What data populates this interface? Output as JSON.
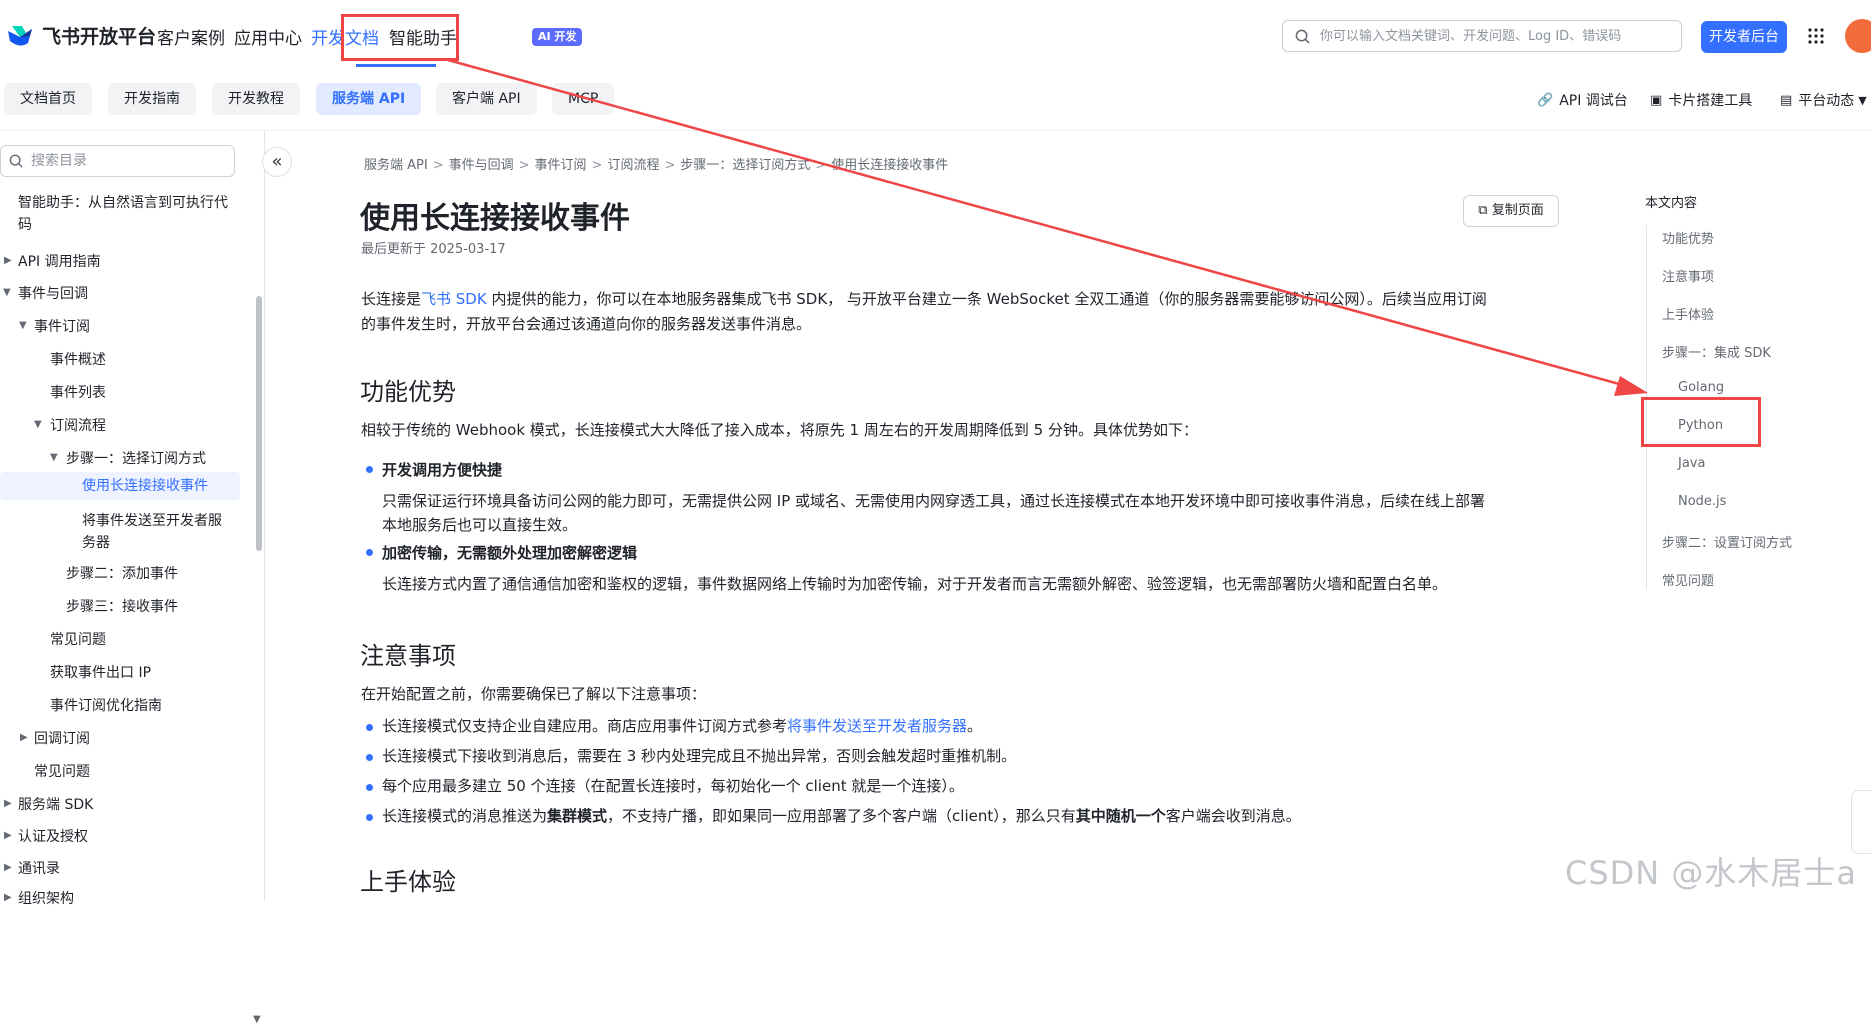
{
  "brand": {
    "name": "飞书开放平台"
  },
  "nav": {
    "items": [
      "客户案例",
      "应用中心",
      "开发文档",
      "智能助手"
    ],
    "ai_badge": "AI 开发"
  },
  "search": {
    "placeholder": "你可以输入文档关键词、开发问题、Log ID、错误码"
  },
  "header": {
    "dev_button": "开发者后台"
  },
  "subnav": {
    "tabs": [
      "文档首页",
      "开发指南",
      "开发教程",
      "服务端 API",
      "客户端 API",
      "MCP"
    ],
    "tools": [
      "API 调试台",
      "卡片搭建工具",
      "平台动态"
    ]
  },
  "sidebar": {
    "search_placeholder": "搜索目录",
    "items": [
      "智能助手：从自然语言到可执行代",
      "码",
      "API 调用指南",
      "事件与回调",
      "事件订阅",
      "事件概述",
      "事件列表",
      "订阅流程",
      "步骤一：选择订阅方式",
      "使用长连接接收事件",
      "将事件发送至开发者服",
      "务器",
      "步骤二：添加事件",
      "步骤三：接收事件",
      "常见问题",
      "获取事件出口 IP",
      "事件订阅优化指南",
      "回调订阅",
      "常见问题",
      "服务端 SDK",
      "认证及授权",
      "通讯录",
      "组织架构"
    ]
  },
  "breadcrumb": [
    "服务端 API",
    "事件与回调",
    "事件订阅",
    "订阅流程",
    "步骤一：选择订阅方式",
    "使用长连接接收事件"
  ],
  "article": {
    "title": "使用长连接接收事件",
    "updated": "最后更新于 2025-03-17",
    "copy_button": "复制页面",
    "intro_1": "长连接是",
    "intro_link": "飞书 SDK",
    "intro_2": " 内提供的能力，你可以在本地服务器集成飞书 SDK， 与开放平台建立一条 WebSocket 全双工通道（你的服务器需要能够访问公网）。后续当应用订阅",
    "intro_3": "的事件发生时，开放平台会通过该通道向你的服务器发送事件消息。",
    "sec1_title": "功能优势",
    "sec1_intro": "相较于传统的 Webhook 模式，长连接模式大大降低了接入成本，将原先 1 周左右的开发周期降低到 5 分钟。具体优势如下：",
    "adv1_title": "开发调用方便快捷",
    "adv1_line1": "只需保证运行环境具备访问公网的能力即可，无需提供公网 IP 或域名、无需使用内网穿透工具，通过长连接模式在本地开发环境中即可接收事件消息，后续在线上部署",
    "adv1_line2": "本地服务后也可以直接生效。",
    "adv2_title": "加密传输，无需额外处理加密解密逻辑",
    "adv2_text": "长连接方式内置了通信通信加密和鉴权的逻辑，事件数据网络上传输时为加密传输，对于开发者而言无需额外解密、验签逻辑，也无需部署防火墙和配置白名单。",
    "sec2_title": "注意事项",
    "sec2_intro": "在开始配置之前，你需要确保已了解以下注意事项：",
    "note1_a": "长连接模式仅支持企业自建应用。商店应用事件订阅方式参考",
    "note1_link": "将事件发送至开发者服务器",
    "note1_b": "。",
    "note2": "长连接模式下接收到消息后，需要在 3 秒内处理完成且不抛出异常，否则会触发超时重推机制。",
    "note3": "每个应用最多建立 50 个连接（在配置长连接时，每初始化一个 client 就是一个连接）。",
    "note4_a": "长连接模式的消息推送为",
    "note4_b": "集群模式",
    "note4_c": "，不支持广播，即如果同一应用部署了多个客户端（client），那么只有",
    "note4_d": "其中随机一个",
    "note4_e": "客户端会收到消息。",
    "sec3_title": "上手体验"
  },
  "toc": {
    "title": "本文内容",
    "items": [
      "功能优势",
      "注意事项",
      "上手体验",
      "步骤一：集成 SDK",
      "Golang",
      "Python",
      "Java",
      "Node.js",
      "步骤二：设置订阅方式",
      "常见问题"
    ]
  },
  "watermark": "CSDN @水木居士a",
  "colors": {
    "accent": "#3370ff",
    "annotation": "#f04545"
  }
}
